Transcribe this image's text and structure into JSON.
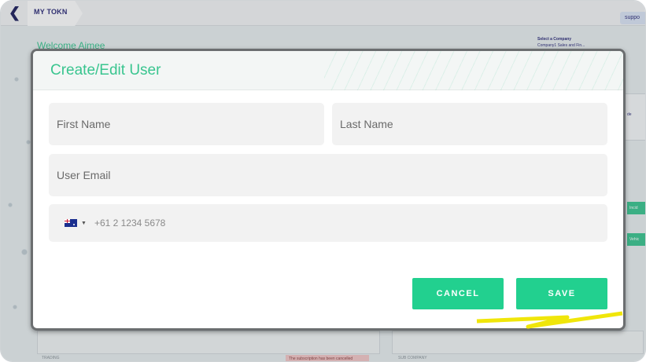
{
  "app": {
    "brand": "MY TOKN",
    "support_label": "suppo",
    "welcome": "Welcome Aimee",
    "company_label": "Select a Company",
    "company_value": "Company1 Sales and Fin...",
    "bg_badge": "The subscription has been cancelled",
    "bg_label_a": "TRADING",
    "bg_label_b": "SUB COMPANY",
    "bg_side_text": "de",
    "bg_side_tag_1": "Incid",
    "bg_side_tag_2": "Vehic"
  },
  "modal": {
    "title": "Create/Edit User",
    "first_name_placeholder": "First Name",
    "last_name_placeholder": "Last Name",
    "email_placeholder": "User Email",
    "phone": {
      "country_icon": "australia-flag-icon",
      "dropdown_icon": "caret-down-icon",
      "placeholder": "+61 2 1234 5678"
    },
    "cancel_label": "CANCEL",
    "save_label": "SAVE"
  },
  "colors": {
    "accent": "#22d08f",
    "title_green": "#39c58f",
    "brand_navy": "#2b2a78",
    "modal_border": "#6b6e70",
    "highlight": "#f0e60a"
  }
}
